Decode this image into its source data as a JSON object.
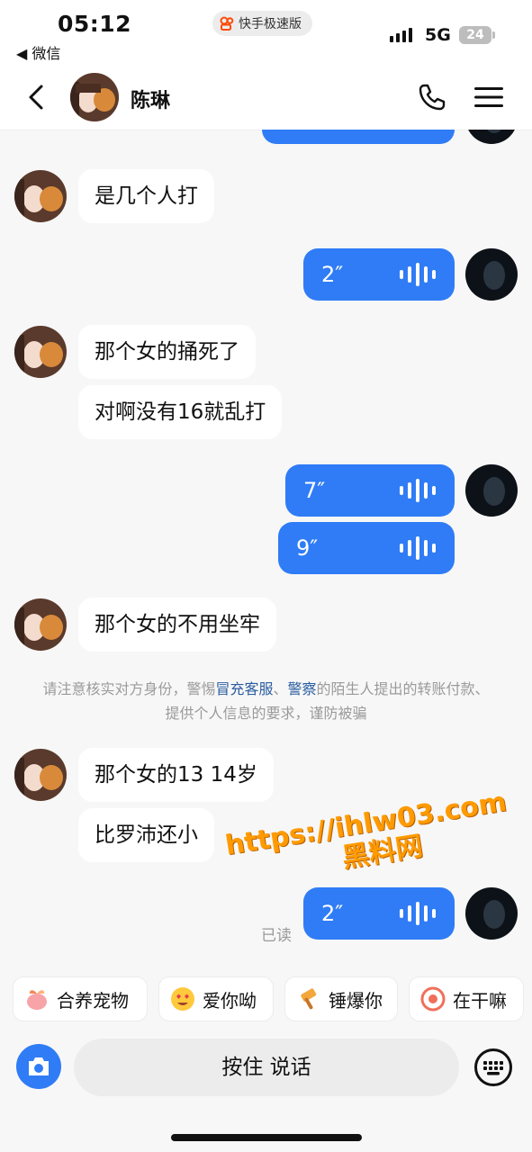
{
  "status_bar": {
    "time": "05:12",
    "back_app": "◀ 微信",
    "app_name": "快手极速版",
    "network": "5G",
    "battery": "24"
  },
  "header": {
    "contact_name": "陈琳"
  },
  "messages": {
    "in_1": "是几个人打",
    "out_1": "2″",
    "in_2": "那个女的捅死了",
    "in_3": "对啊没有16就乱打",
    "out_2": "7″",
    "out_3": "9″",
    "in_4": "那个女的不用坐牢",
    "notice_a": "请注意核实对方身份，警惕",
    "notice_b": "冒充客服",
    "notice_c": "、",
    "notice_d": "警察",
    "notice_e": "的陌生人提出的转账付款、提供个人信息的要求，谨防被骗",
    "in_5": "那个女的13 14岁",
    "in_6": "比罗沛还小",
    "out_4": "2″",
    "read_status": "已读"
  },
  "watermark": {
    "line1": "https://ihlw03.com",
    "line2": "黑料网"
  },
  "quick_replies": [
    "合养宠物",
    "爱你呦",
    "锤爆你",
    "在干嘛"
  ],
  "input": {
    "hold_to_talk": "按住 说话"
  },
  "colors": {
    "accent": "#2f7cf6",
    "background": "#f7f7f7",
    "watermark": "#ff9b00"
  }
}
